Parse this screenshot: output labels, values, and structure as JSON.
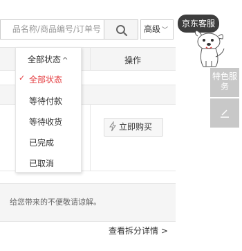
{
  "search": {
    "placeholder": "品名称/商品编号/订单号",
    "advanced_label": "高级"
  },
  "table": {
    "status_header": "全部状态",
    "action_header": "操作"
  },
  "status_dropdown": {
    "items": [
      {
        "label": "全部状态",
        "selected": true
      },
      {
        "label": "等待付款",
        "selected": false
      },
      {
        "label": "等待收货",
        "selected": false
      },
      {
        "label": "已完成",
        "selected": false
      },
      {
        "label": "已取消",
        "selected": false
      }
    ]
  },
  "order": {
    "buy_now_label": "立即购买"
  },
  "notice": {
    "text": "给您带来的不便敬请谅解。",
    "link": "查看拆分详情 >"
  },
  "sidebar": {
    "customer_service_bubble": "京东客服",
    "special_service_label": "特色服务"
  },
  "colors": {
    "accent": "#e4393c",
    "sidebar_tab": "#c8c8c8",
    "bubble": "#3d3d3d"
  }
}
